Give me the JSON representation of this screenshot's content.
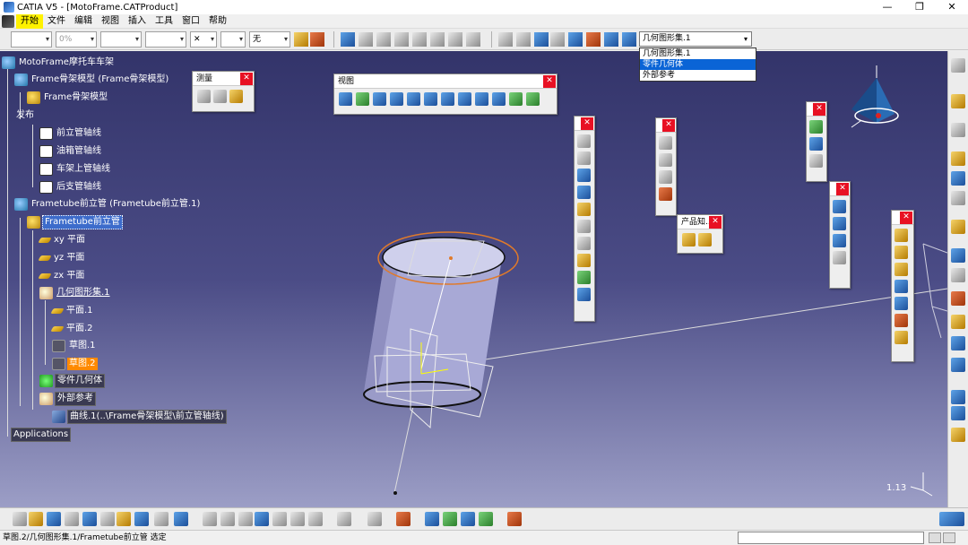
{
  "window": {
    "title": "CATIA V5 - [MotoFrame.CATProduct]",
    "minimize": "—",
    "maximize": "❐",
    "close": "✕"
  },
  "menu": [
    {
      "label": "开始",
      "active": true
    },
    {
      "label": "文件"
    },
    {
      "label": "编辑"
    },
    {
      "label": "视图"
    },
    {
      "label": "插入"
    },
    {
      "label": "工具"
    },
    {
      "label": "窗口"
    },
    {
      "label": "帮助"
    }
  ],
  "toolbar_top": {
    "transparency": "0%",
    "layer": "无",
    "current_geometrical_set": "几何图形集.1"
  },
  "geomset_dropdown": {
    "options": [
      "几何图形集.1",
      "零件几何体",
      "外部参考"
    ],
    "selected_index": 1
  },
  "tree": {
    "root": "MotoFrame摩托车车架",
    "frame_model": "Frame骨架模型 (Frame骨架模型)",
    "frame_model_part": "Frame骨架模型",
    "publication": "发布",
    "pub_items": [
      "前立管轴线",
      "油箱管轴线",
      "车架上管轴线",
      "后支管轴线"
    ],
    "frametube": "Frametube前立管 (Frametube前立管.1)",
    "frametube_part": "Frametube前立管",
    "planes": [
      "xy 平面",
      "yz 平面",
      "zx 平面"
    ],
    "geomset": "几何图形集.1",
    "geomset_children": [
      "平面.1",
      "平面.2",
      "草图.1",
      "草图.2"
    ],
    "part_body": "零件几何体",
    "external_ref": "外部参考",
    "curve": "曲线.1(..\\Frame骨架模型\\前立管轴线)",
    "applications": "Applications"
  },
  "panels": {
    "measure": {
      "title": "测量"
    },
    "view": {
      "title": "视图"
    },
    "product_knowledge": {
      "title": "产品知..."
    }
  },
  "statusbar": {
    "message": "草图.2/几何图形集.1/Frametube前立管 选定"
  },
  "viewport": {
    "zoom_readout": "1.13"
  },
  "colors": {
    "background_top": "#33346a",
    "background_bottom": "#9c9ec6",
    "selection_orange": "#ff8a00",
    "selection_blue": "#3d6ccb",
    "close_red": "#e81123",
    "dropdown_selected": "#0a64d6"
  }
}
